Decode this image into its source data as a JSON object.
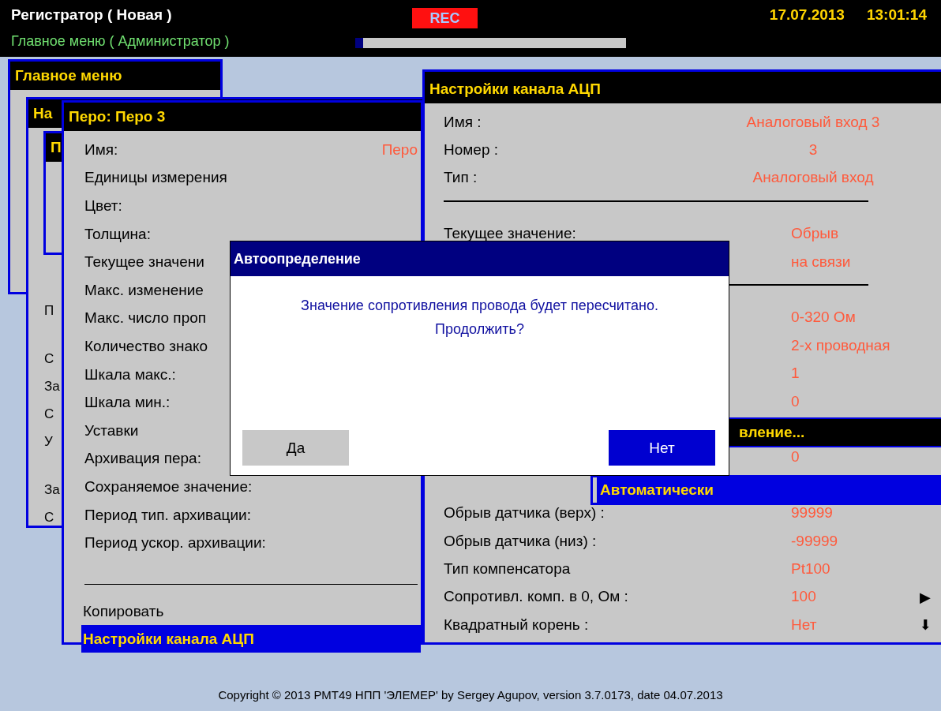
{
  "top_bar": {
    "title": "Регистратор ( Новая )",
    "subtitle": "Главное меню ( Администратор )",
    "rec": "REC",
    "progress": {
      "level": 0.03
    },
    "date": "17.07.2013",
    "time": "13:01:14"
  },
  "main_menu_window": {
    "title": "Главное меню"
  },
  "back_window": {
    "title": "На",
    "items": [
      {
        "kind": "text",
        "label": "П"
      },
      {
        "kind": "rule"
      },
      {
        "kind": "text",
        "label": "С"
      },
      {
        "kind": "text",
        "label": "За"
      },
      {
        "kind": "text",
        "label": "С"
      },
      {
        "kind": "text",
        "label": "У"
      },
      {
        "kind": "rule"
      },
      {
        "kind": "text",
        "label": "За"
      },
      {
        "kind": "text",
        "label": "С"
      }
    ]
  },
  "inner_window": {
    "title": "П"
  },
  "pen_window": {
    "title": "Перо: Перо 3",
    "rows": [
      {
        "label": "Имя:",
        "value": "Перо"
      },
      {
        "label": "Единицы измерения"
      },
      {
        "label": "Цвет:"
      },
      {
        "label": "Толщина:"
      },
      {
        "label": "Текущее значени"
      },
      {
        "label": "Макс. изменение"
      },
      {
        "label": "Макс. число проп"
      },
      {
        "label": "Количество знако"
      },
      {
        "label": "Шкала макс.:"
      },
      {
        "label": "Шкала мин.:"
      },
      {
        "label": "Уставки"
      },
      {
        "label": "Архивация пера:"
      },
      {
        "label": "Сохраняемое значение:"
      },
      {
        "label": "Период тип. архивации:"
      },
      {
        "label": "Период ускор. архивации:"
      }
    ],
    "actions": [
      {
        "label": "Копировать",
        "selected": false
      },
      {
        "label": "Настройки канала АЦП",
        "selected": true
      }
    ]
  },
  "adc_window": {
    "title": "Настройки канала АЦП",
    "rows": [
      {
        "kind": "info",
        "label": "Имя :",
        "value": "Аналоговый вход 3"
      },
      {
        "kind": "info",
        "label": "Номер :",
        "value": "3"
      },
      {
        "kind": "info",
        "label": "Тип :",
        "value": "Аналоговый вход"
      },
      {
        "kind": "rule"
      },
      {
        "kind": "param",
        "label": "Текущее значение:",
        "value": "Обрыв"
      },
      {
        "kind": "param",
        "value": "на связи"
      },
      {
        "kind": "rule"
      },
      {
        "kind": "param",
        "value": "0-320 Ом"
      },
      {
        "kind": "param",
        "value": "2-х проводная"
      },
      {
        "kind": "param",
        "value": "1"
      },
      {
        "kind": "param",
        "value": "0"
      },
      {
        "kind": "blank"
      },
      {
        "kind": "param",
        "value": "0"
      },
      {
        "kind": "blank"
      },
      {
        "kind": "param",
        "label": "Обрыв датчика (верх) :",
        "value": "99999"
      },
      {
        "kind": "param",
        "label": "Обрыв датчика (низ) :",
        "value": "-99999"
      },
      {
        "kind": "param",
        "label": "Тип компенсатора",
        "value": "Pt100"
      },
      {
        "kind": "param",
        "label": "Сопротивл. комп. в 0, Ом :",
        "value": "100",
        "more": "▶"
      },
      {
        "kind": "param",
        "label": "Квадратный корень :",
        "value": "Нет",
        "more": "⬇"
      }
    ]
  },
  "submenu": {
    "title": "вление..."
  },
  "choice_popup": {
    "items": [
      {
        "label": "Автоматически",
        "selected": true
      }
    ]
  },
  "dialog": {
    "title": "Автоопределение",
    "message": [
      "Значение сопротивления провода будет пересчитано.",
      "Продолжить?"
    ],
    "buttons": [
      {
        "label": "Да",
        "selected": false
      },
      {
        "label": "Нет",
        "selected": true
      }
    ]
  },
  "footer": "Copyright © 2013 РМТ49 НПП 'ЭЛЕМЕР' by Sergey Agupov, version 3.7.0173, date 04.07.2013"
}
